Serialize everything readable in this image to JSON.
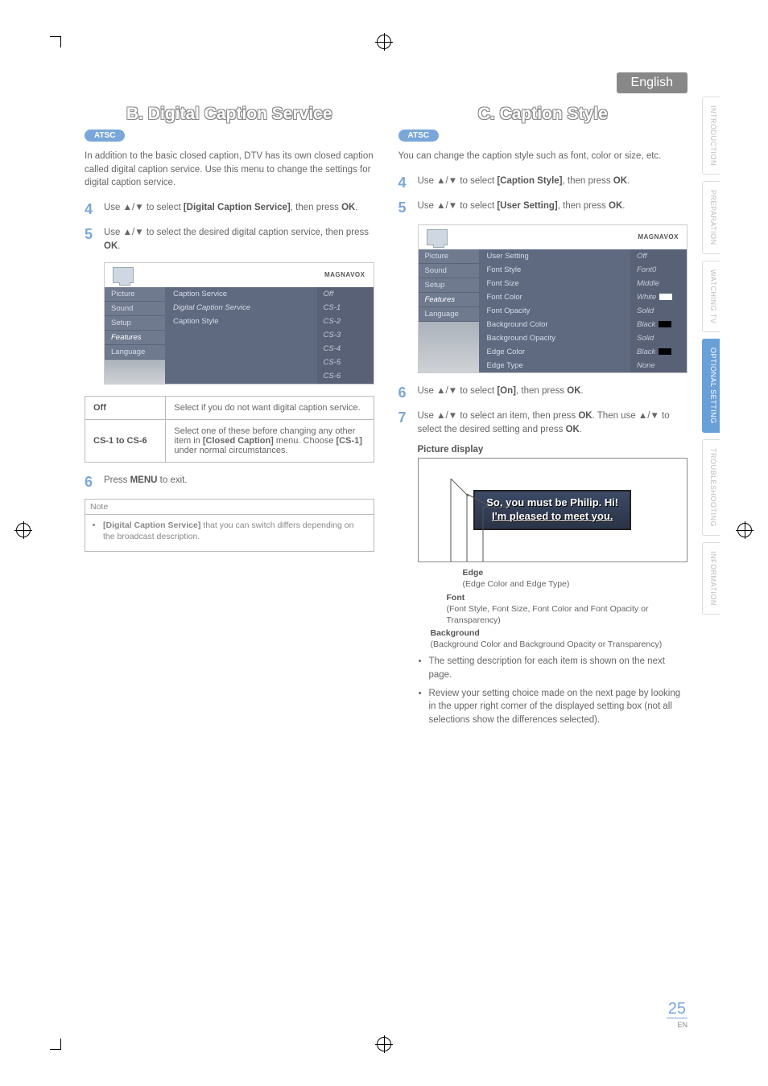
{
  "language_tab": "English",
  "side_tabs": [
    "INTRODUCTION",
    "PREPARATION",
    "WATCHING TV",
    "OPTIONAL SETTING",
    "TROUBLESHOOTING",
    "INFORMATION"
  ],
  "side_tabs_active_index": 3,
  "page_number": "25",
  "page_lang_code": "EN",
  "brand": "MAGNAVOX",
  "sectionB": {
    "title": "B.  Digital Caption Service",
    "pill": "ATSC",
    "intro": "In addition to the basic closed caption, DTV has its own closed caption called digital caption service. Use this menu to change the settings for digital caption service.",
    "step4_num": "4",
    "step4": "Use ▲/▼ to select [Digital Caption Service], then press OK.",
    "step5_num": "5",
    "step5": "Use ▲/▼ to select the desired digital caption service, then press OK.",
    "osd_left": [
      "Picture",
      "Sound",
      "Setup",
      "Features",
      "Language"
    ],
    "osd_left_sel_index": 3,
    "osd_mid": [
      "Caption Service",
      "Digital Caption Service",
      "Caption Style"
    ],
    "osd_mid_sel_index": 1,
    "osd_right": [
      "Off",
      "CS-1",
      "CS-2",
      "CS-3",
      "CS-4",
      "CS-5",
      "CS-6"
    ],
    "def_off_k": "Off",
    "def_off_v": "Select if you do not want digital caption service.",
    "def_cs_k": "CS-1 to CS-6",
    "def_cs_v": "Select one of these before changing any other item in [Closed Caption] menu. Choose [CS-1] under normal circumstances.",
    "step6_num": "6",
    "step6": "Press MENU to exit.",
    "note_head": "Note",
    "note_item": "[Digital Caption Service] that you can switch differs depending on the broadcast description."
  },
  "sectionC": {
    "title": "C.  Caption Style",
    "pill": "ATSC",
    "intro": "You can change the caption style such as font, color or size, etc.",
    "step4_num": "4",
    "step4": "Use ▲/▼ to select [Caption Style], then press OK.",
    "step5_num": "5",
    "step5": "Use ▲/▼ to select [User Setting], then press OK.",
    "osd_left": [
      "Picture",
      "Sound",
      "Setup",
      "Features",
      "Language"
    ],
    "osd_left_sel_index": 3,
    "osd_mid": [
      "User Setting",
      "Font Style",
      "Font Size",
      "Font Color",
      "Font Opacity",
      "Background Color",
      "Background Opacity",
      "Edge Color",
      "Edge Type"
    ],
    "osd_right": [
      {
        "label": "Off"
      },
      {
        "label": "Font0"
      },
      {
        "label": "Middle"
      },
      {
        "label": "White",
        "swatch": "#ffffff"
      },
      {
        "label": "Solid"
      },
      {
        "label": "Black",
        "swatch": "#000000"
      },
      {
        "label": "Solid"
      },
      {
        "label": "Black",
        "swatch": "#000000"
      },
      {
        "label": "None"
      }
    ],
    "step6_num": "6",
    "step6": "Use ▲/▼ to select [On], then press OK.",
    "step7_num": "7",
    "step7": "Use ▲/▼ to select an item, then press OK. Then use ▲/▼ to select the desired setting and press OK.",
    "picture_display_label": "Picture display",
    "picture_line1": "So, you must be Philip. Hi!",
    "picture_line2": "I'm pleased to meet you.",
    "anno_edge_hd": "Edge",
    "anno_edge": "(Edge Color and Edge Type)",
    "anno_font_hd": "Font",
    "anno_font": "(Font Style, Font Size, Font Color and Font Opacity or Transparency)",
    "anno_bg_hd": "Background",
    "anno_bg": "(Background Color and Background Opacity or Transparency)",
    "bullet1": "The setting description for each item is shown on the next page.",
    "bullet2": "Review your setting choice made on the next page by looking in the upper right corner of the displayed setting box (not all selections show the differences selected)."
  }
}
